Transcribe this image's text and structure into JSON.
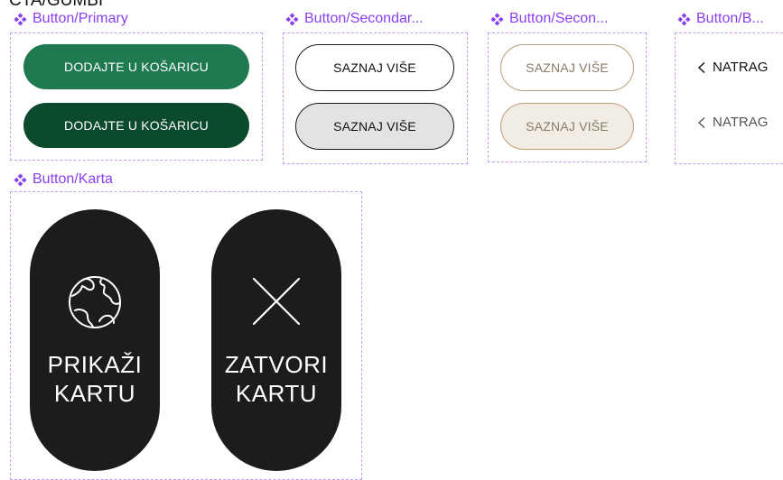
{
  "page": {
    "title": "CTA/GUMBI"
  },
  "colors": {
    "component_label": "#8a3ff0",
    "frame_border": "#c59cf5",
    "primary": "#207a50",
    "primary_dark": "#0c4a2d",
    "gold": "#b79e7a",
    "map_button": "#1c1c1c"
  },
  "components": {
    "primary": {
      "label": "Button/Primary",
      "buttons": [
        {
          "label": "DODAJTE U KOŠARICU",
          "state": "default"
        },
        {
          "label": "DODAJTE U KOŠARICU",
          "state": "hover"
        }
      ]
    },
    "secondary": {
      "label": "Button/Secondar...",
      "buttons": [
        {
          "label": "SAZNAJ VIŠE",
          "state": "default"
        },
        {
          "label": "SAZNAJ VIŠE",
          "state": "hover"
        }
      ]
    },
    "secondary_gold": {
      "label": "Button/Secon...",
      "buttons": [
        {
          "label": "SAZNAJ VIŠE",
          "state": "default"
        },
        {
          "label": "SAZNAJ VIŠE",
          "state": "hover"
        }
      ]
    },
    "back": {
      "label": "Button/B...",
      "buttons": [
        {
          "label": "NATRAG",
          "state": "default",
          "icon": "chevron-left-icon"
        },
        {
          "label": "NATRAG",
          "state": "hover",
          "icon": "chevron-left-icon"
        }
      ]
    },
    "map": {
      "label": "Button/Karta",
      "buttons": [
        {
          "label": "PRIKAŽI\nKARTU",
          "icon": "globe-icon"
        },
        {
          "label": "ZATVORI\nKARTU",
          "icon": "close-icon"
        }
      ]
    }
  }
}
